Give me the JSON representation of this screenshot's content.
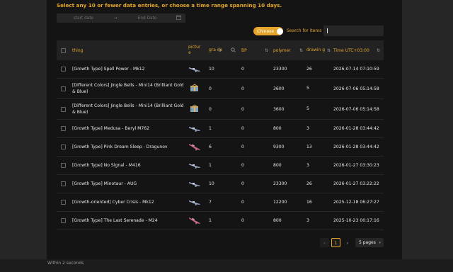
{
  "notice": "Select any 10 or fewer data entries, or choose a time range spanning 10 days.",
  "date_range": {
    "start_placeholder": "start date",
    "separator": "→",
    "end_placeholder": "End Date"
  },
  "language_toggle": {
    "label": "Chinese",
    "on": true
  },
  "search": {
    "label": "Search for items",
    "value": ""
  },
  "table": {
    "headers": {
      "thing": "thing",
      "picture": "pictur e",
      "grade": "gra de",
      "bp": "BP",
      "polymer": "polymer",
      "drawing": "drawin g",
      "time": "Time UTC+03:00"
    },
    "rows": [
      {
        "thing": "[Growth Type] Spell Power - Mk12",
        "icon": "rifle-icon",
        "grade": "10",
        "bp": "0",
        "polymer": "23300",
        "drawing": "26",
        "time": "2026-07-14 07:10:59"
      },
      {
        "thing": "[Different Colors] Jingle Bells - Mini14 (Brilliant Gold & Blue)",
        "icon": "gift-box-icon",
        "grade": "0",
        "bp": "0",
        "polymer": "3600",
        "drawing": "5",
        "time": "2026-07-06 05:14:58"
      },
      {
        "thing": "[Different Colors] Jingle Bells - Mini14 (Brilliant Gold & Blue)",
        "icon": "gift-box-icon",
        "grade": "0",
        "bp": "0",
        "polymer": "3600",
        "drawing": "5",
        "time": "2026-07-06 05:14:58"
      },
      {
        "thing": "[Growth Type] Medusa - Beryl M762",
        "icon": "rifle-icon",
        "grade": "1",
        "bp": "0",
        "polymer": "800",
        "drawing": "3",
        "time": "2026-01-28 03:44:42"
      },
      {
        "thing": "[Growth Type] Pink Dream Sleep - Dragunov",
        "icon": "sniper-icon",
        "grade": "6",
        "bp": "0",
        "polymer": "9300",
        "drawing": "13",
        "time": "2026-01-28 03:44:42"
      },
      {
        "thing": "[Growth Type] No Signal - M416",
        "icon": "rifle-icon",
        "grade": "1",
        "bp": "0",
        "polymer": "800",
        "drawing": "3",
        "time": "2026-01-27 03:30:23"
      },
      {
        "thing": "[Growth Type] Minotaur - AUG",
        "icon": "rifle-icon",
        "grade": "10",
        "bp": "0",
        "polymer": "23300",
        "drawing": "26",
        "time": "2026-01-27 03:22:22"
      },
      {
        "thing": "[Growth-oriented] Cyber Crisis - Mk12",
        "icon": "rifle-icon",
        "grade": "7",
        "bp": "0",
        "polymer": "12200",
        "drawing": "16",
        "time": "2025-12-18 06:27:27"
      },
      {
        "thing": "[Growth Type] The Last Serenade - M24",
        "icon": "sniper-icon",
        "grade": "1",
        "bp": "0",
        "polymer": "800",
        "drawing": "3",
        "time": "2025-10-23 00:17:16"
      }
    ]
  },
  "pagination": {
    "prev": "‹",
    "current": "1",
    "next": "›",
    "page_size": "5 pages"
  },
  "footer": "Within 2 seconds",
  "colors": {
    "accent": "#e4a52a",
    "panel": "#141414",
    "header": "#222222"
  }
}
